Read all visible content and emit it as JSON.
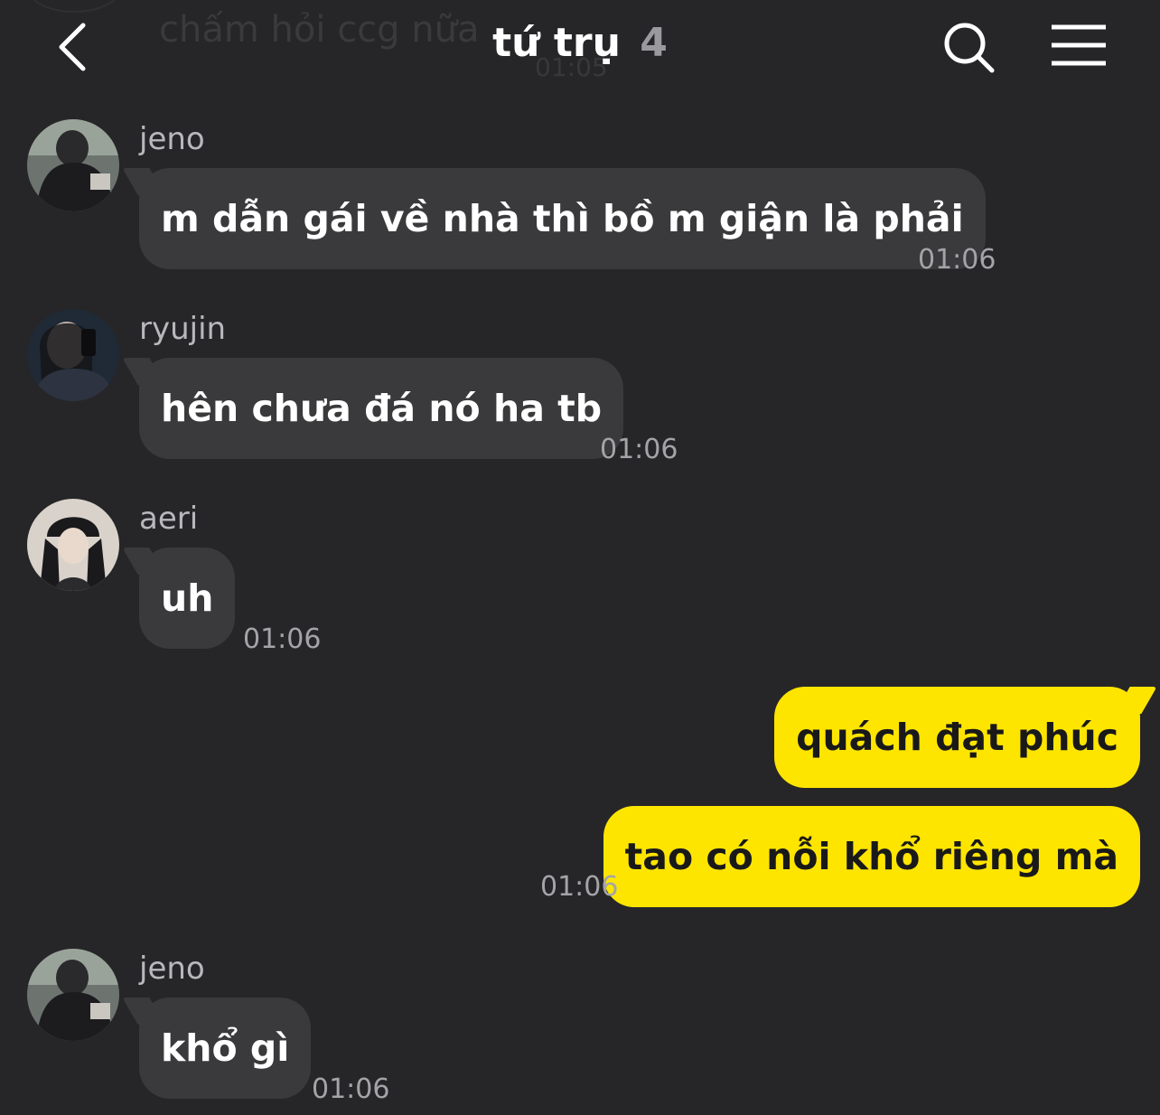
{
  "header": {
    "title": "tứ trụ",
    "member_count": "4",
    "back_icon": "chevron-left-icon",
    "search_icon": "search-icon",
    "menu_icon": "hamburger-menu-icon"
  },
  "ghost_message": {
    "text": "chấm hỏi ccg nữa",
    "time": "01:05"
  },
  "messages": [
    {
      "sender": "jeno",
      "text": "m dẫn gái về nhà thì bồ m giận là phải",
      "time": "01:06",
      "direction": "incoming"
    },
    {
      "sender": "ryujin",
      "text": "hên chưa đá nó ha tb",
      "time": "01:06",
      "direction": "incoming"
    },
    {
      "sender": "aeri",
      "text": "uh",
      "time": "01:06",
      "direction": "incoming"
    },
    {
      "text": "quách đạt phúc",
      "direction": "outgoing"
    },
    {
      "text": "tao có nỗi khổ riêng mà",
      "time": "01:06",
      "direction": "outgoing"
    },
    {
      "sender": "jeno",
      "text": "khổ gì",
      "time": "01:06",
      "direction": "incoming"
    }
  ],
  "colors": {
    "background": "#262628",
    "incoming_bubble": "#3a3a3c",
    "outgoing_bubble": "#fee500",
    "outgoing_text": "#19191a",
    "timestamp": "#a4a4a8"
  }
}
